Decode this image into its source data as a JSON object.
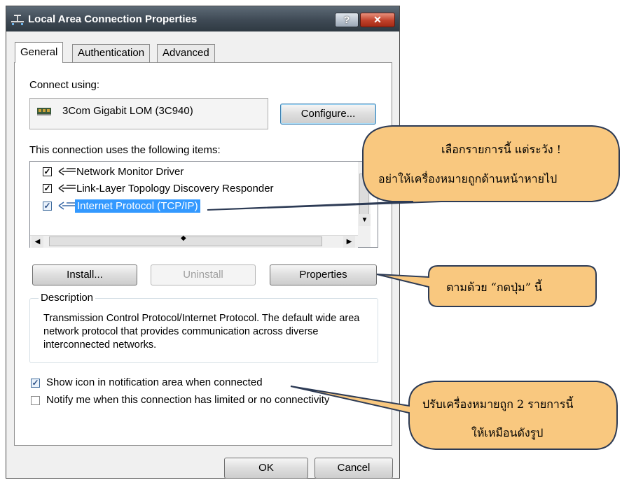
{
  "window": {
    "title": "Local Area Connection Properties",
    "help_label": "?",
    "close_label": "✕"
  },
  "tabs": [
    {
      "label": "General"
    },
    {
      "label": "Authentication"
    },
    {
      "label": "Advanced"
    }
  ],
  "connect_using": {
    "label": "Connect using:",
    "adapter_name": "3Com Gigabit LOM (3C940)",
    "configure_label": "Configure..."
  },
  "items_section": {
    "label": "This connection uses the following items:",
    "items": [
      {
        "label": "Network Monitor Driver",
        "checked": true,
        "selected": false
      },
      {
        "label": "Link-Layer Topology Discovery Responder",
        "checked": true,
        "selected": false
      },
      {
        "label": "Internet Protocol (TCP/IP)",
        "checked": true,
        "selected": true
      }
    ]
  },
  "buttons": {
    "install": "Install...",
    "uninstall": "Uninstall",
    "properties": "Properties",
    "ok": "OK",
    "cancel": "Cancel"
  },
  "description": {
    "legend": "Description",
    "text": "Transmission Control Protocol/Internet Protocol. The default wide area network protocol that provides communication across diverse interconnected networks."
  },
  "options": {
    "show_icon": {
      "label": "Show icon in notification area when connected",
      "checked": true
    },
    "notify_me": {
      "label": "Notify me when this connection has limited or no connectivity",
      "checked": false
    }
  },
  "callouts": {
    "select_item": {
      "line1": "เลือกรายการนี้ แต่ระวัง !",
      "line2": "อย่าให้เครื่องหมายถูกด้านหน้าหายไป"
    },
    "press_button": {
      "line1": "ตามด้วย “กดปุ่ม” นี้"
    },
    "adjust_checks": {
      "line1": "ปรับเครื่องหมายถูก 2 รายการนี้",
      "line2": "ให้เหมือนดังรูป"
    }
  },
  "colors": {
    "callout_fill": "#f9c87f",
    "selection": "#3399ff"
  }
}
